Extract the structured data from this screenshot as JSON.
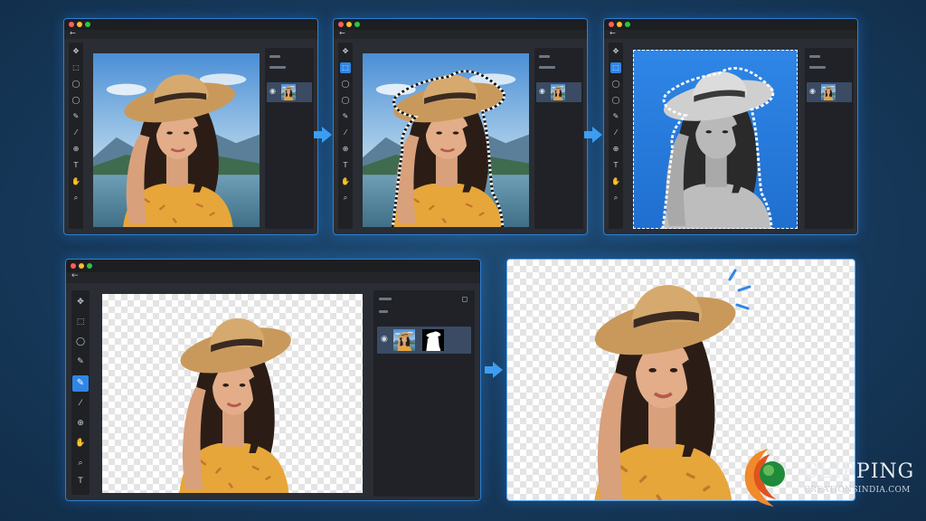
{
  "colors": {
    "background": "#173a5c",
    "window_border": "#2f7fd0",
    "accent": "#2f86e6",
    "selection_blue": "#2f86e6"
  },
  "steps": [
    {
      "name": "original-photo",
      "tool_active": "none"
    },
    {
      "name": "selection-around-subject",
      "tool_active": "marquee-tool"
    },
    {
      "name": "background-selected-inverted",
      "tool_active": "marquee-tool"
    },
    {
      "name": "layer-mask-applied",
      "tool_active": "refine-brush-tool"
    },
    {
      "name": "final-transparent-result",
      "tool_active": "none"
    }
  ],
  "tools": [
    "move-icon",
    "marquee-icon",
    "lasso-icon",
    "quick-select-icon",
    "brush-icon",
    "eyedropper-icon",
    "clone-icon",
    "type-icon",
    "hand-icon",
    "zoom-icon"
  ],
  "glyphs": {
    "move": "✥",
    "marquee": "⬚",
    "lasso": "◯",
    "brush": "✎",
    "eyedrop": "⁄",
    "clone": "⊕",
    "type": "T",
    "hand": "✋",
    "zoom": "⌕",
    "eye": "◉",
    "back": "←"
  },
  "logo": {
    "line1": "CLIPPING",
    "line2": "CREATIONSINDIA.COM"
  }
}
